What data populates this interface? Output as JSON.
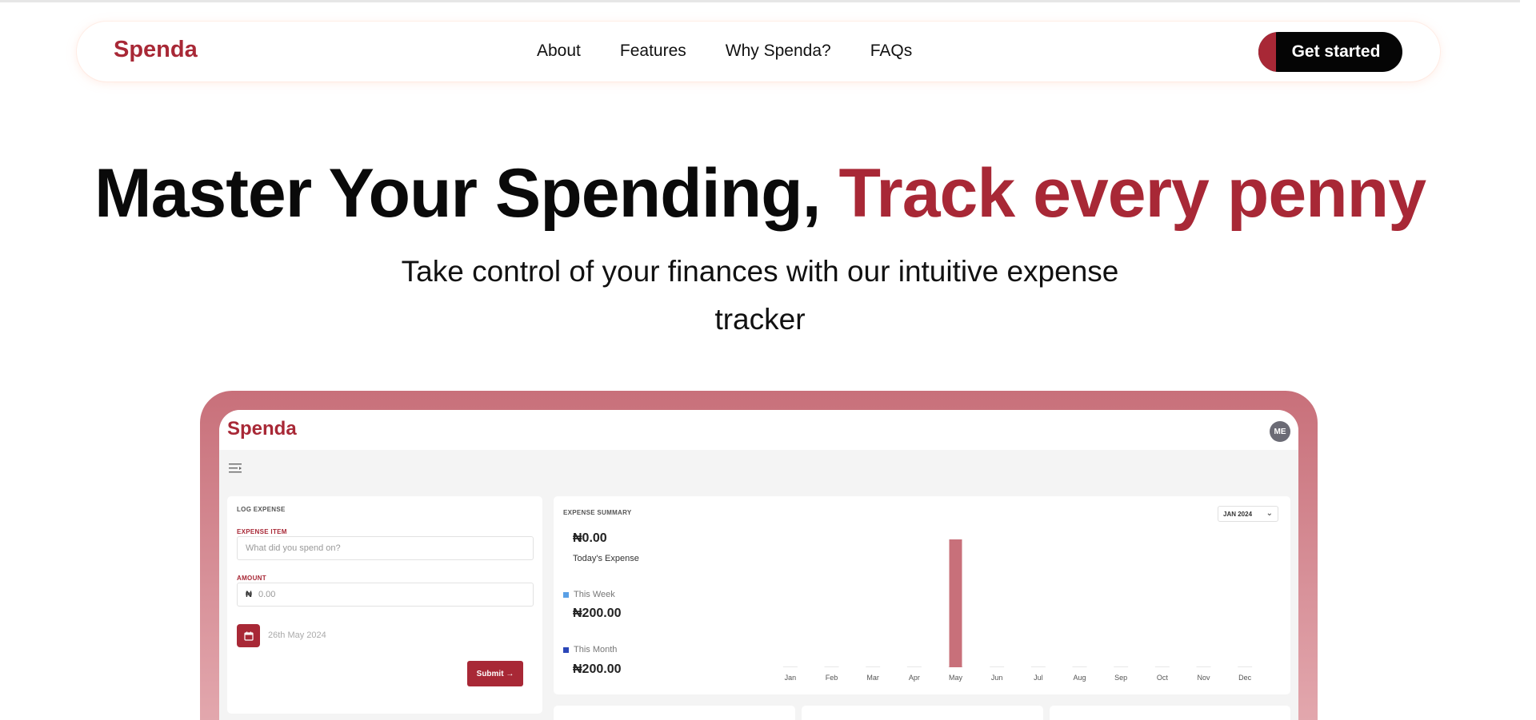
{
  "nav": {
    "brand": "Spenda",
    "links": [
      "About",
      "Features",
      "Why Spenda?",
      "FAQs"
    ],
    "cta": "Get started"
  },
  "hero": {
    "title_main": "Master Your Spending,",
    "title_accent": "Track every penny",
    "subtitle_line1": "Take control of your finances with our intuitive expense",
    "subtitle_line2": "tracker"
  },
  "app": {
    "brand": "Spenda",
    "avatar": "ME",
    "log": {
      "heading": "LOG EXPENSE",
      "item_label": "EXPENSE ITEM",
      "item_placeholder": "What did you spend on?",
      "amount_label": "AMOUNT",
      "currency": "₦",
      "amount_placeholder": "0.00",
      "date": "26th May 2024",
      "submit": "Submit →"
    },
    "summary": {
      "heading": "EXPENSE SUMMARY",
      "month": "JAN 2024",
      "today_amount": "₦0.00",
      "today_label": "Today's Expense",
      "week_label": "This Week",
      "week_amount": "₦200.00",
      "month_label": "This Month",
      "month_amount": "₦200.00"
    }
  },
  "colors": {
    "brand": "#a82836",
    "week": "#5aa0e6",
    "month": "#2b46b8",
    "bar": "#c8707a"
  },
  "chart_data": {
    "type": "bar",
    "categories": [
      "Jan",
      "Feb",
      "Mar",
      "Apr",
      "May",
      "Jun",
      "Jul",
      "Aug",
      "Sep",
      "Oct",
      "Nov",
      "Dec"
    ],
    "values": [
      0,
      0,
      0,
      0,
      200,
      0,
      0,
      0,
      0,
      0,
      0,
      0
    ],
    "ylim": [
      0,
      200
    ],
    "grid": false
  }
}
